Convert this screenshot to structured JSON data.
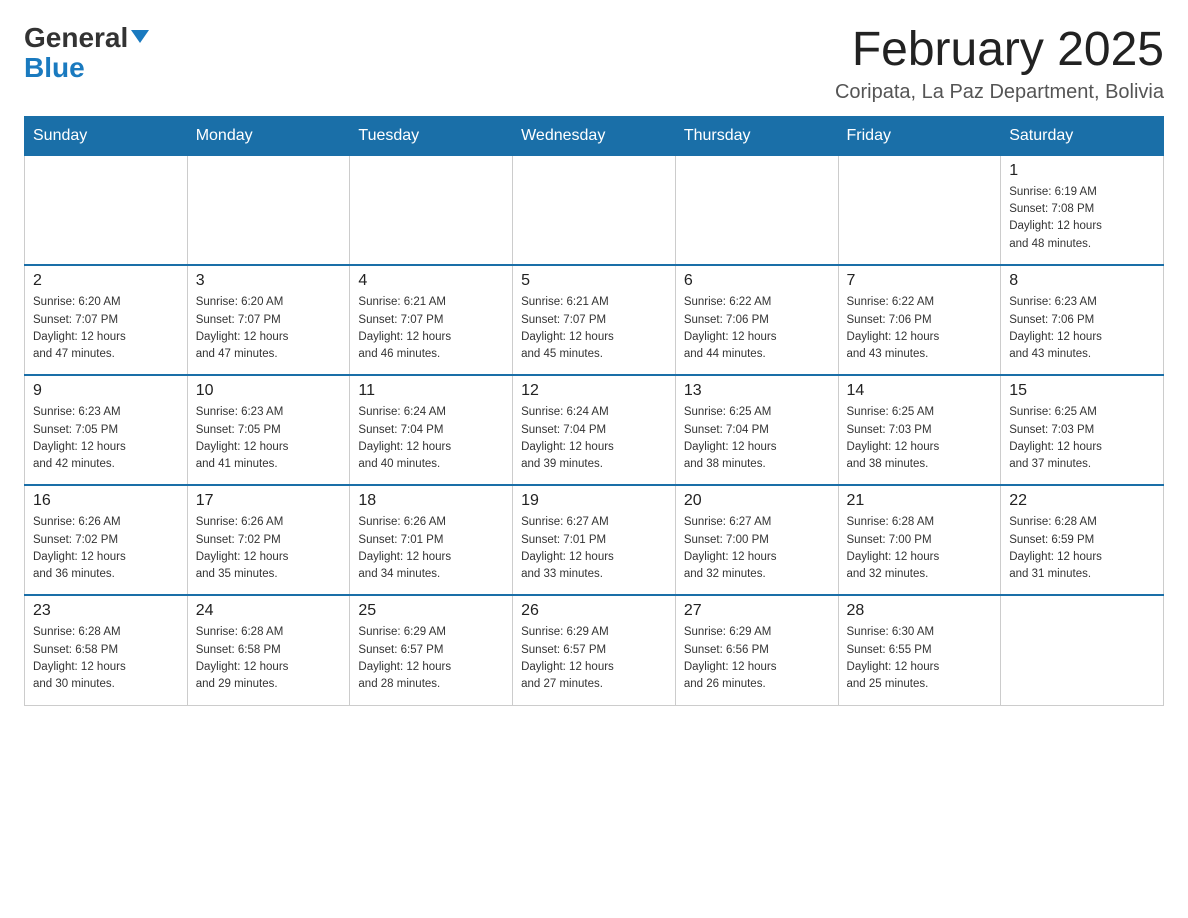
{
  "logo": {
    "part1": "General",
    "part2": "Blue"
  },
  "title": {
    "month": "February 2025",
    "location": "Coripata, La Paz Department, Bolivia"
  },
  "headers": [
    "Sunday",
    "Monday",
    "Tuesday",
    "Wednesday",
    "Thursday",
    "Friday",
    "Saturday"
  ],
  "weeks": [
    [
      {
        "day": "",
        "info": ""
      },
      {
        "day": "",
        "info": ""
      },
      {
        "day": "",
        "info": ""
      },
      {
        "day": "",
        "info": ""
      },
      {
        "day": "",
        "info": ""
      },
      {
        "day": "",
        "info": ""
      },
      {
        "day": "1",
        "info": "Sunrise: 6:19 AM\nSunset: 7:08 PM\nDaylight: 12 hours\nand 48 minutes."
      }
    ],
    [
      {
        "day": "2",
        "info": "Sunrise: 6:20 AM\nSunset: 7:07 PM\nDaylight: 12 hours\nand 47 minutes."
      },
      {
        "day": "3",
        "info": "Sunrise: 6:20 AM\nSunset: 7:07 PM\nDaylight: 12 hours\nand 47 minutes."
      },
      {
        "day": "4",
        "info": "Sunrise: 6:21 AM\nSunset: 7:07 PM\nDaylight: 12 hours\nand 46 minutes."
      },
      {
        "day": "5",
        "info": "Sunrise: 6:21 AM\nSunset: 7:07 PM\nDaylight: 12 hours\nand 45 minutes."
      },
      {
        "day": "6",
        "info": "Sunrise: 6:22 AM\nSunset: 7:06 PM\nDaylight: 12 hours\nand 44 minutes."
      },
      {
        "day": "7",
        "info": "Sunrise: 6:22 AM\nSunset: 7:06 PM\nDaylight: 12 hours\nand 43 minutes."
      },
      {
        "day": "8",
        "info": "Sunrise: 6:23 AM\nSunset: 7:06 PM\nDaylight: 12 hours\nand 43 minutes."
      }
    ],
    [
      {
        "day": "9",
        "info": "Sunrise: 6:23 AM\nSunset: 7:05 PM\nDaylight: 12 hours\nand 42 minutes."
      },
      {
        "day": "10",
        "info": "Sunrise: 6:23 AM\nSunset: 7:05 PM\nDaylight: 12 hours\nand 41 minutes."
      },
      {
        "day": "11",
        "info": "Sunrise: 6:24 AM\nSunset: 7:04 PM\nDaylight: 12 hours\nand 40 minutes."
      },
      {
        "day": "12",
        "info": "Sunrise: 6:24 AM\nSunset: 7:04 PM\nDaylight: 12 hours\nand 39 minutes."
      },
      {
        "day": "13",
        "info": "Sunrise: 6:25 AM\nSunset: 7:04 PM\nDaylight: 12 hours\nand 38 minutes."
      },
      {
        "day": "14",
        "info": "Sunrise: 6:25 AM\nSunset: 7:03 PM\nDaylight: 12 hours\nand 38 minutes."
      },
      {
        "day": "15",
        "info": "Sunrise: 6:25 AM\nSunset: 7:03 PM\nDaylight: 12 hours\nand 37 minutes."
      }
    ],
    [
      {
        "day": "16",
        "info": "Sunrise: 6:26 AM\nSunset: 7:02 PM\nDaylight: 12 hours\nand 36 minutes."
      },
      {
        "day": "17",
        "info": "Sunrise: 6:26 AM\nSunset: 7:02 PM\nDaylight: 12 hours\nand 35 minutes."
      },
      {
        "day": "18",
        "info": "Sunrise: 6:26 AM\nSunset: 7:01 PM\nDaylight: 12 hours\nand 34 minutes."
      },
      {
        "day": "19",
        "info": "Sunrise: 6:27 AM\nSunset: 7:01 PM\nDaylight: 12 hours\nand 33 minutes."
      },
      {
        "day": "20",
        "info": "Sunrise: 6:27 AM\nSunset: 7:00 PM\nDaylight: 12 hours\nand 32 minutes."
      },
      {
        "day": "21",
        "info": "Sunrise: 6:28 AM\nSunset: 7:00 PM\nDaylight: 12 hours\nand 32 minutes."
      },
      {
        "day": "22",
        "info": "Sunrise: 6:28 AM\nSunset: 6:59 PM\nDaylight: 12 hours\nand 31 minutes."
      }
    ],
    [
      {
        "day": "23",
        "info": "Sunrise: 6:28 AM\nSunset: 6:58 PM\nDaylight: 12 hours\nand 30 minutes."
      },
      {
        "day": "24",
        "info": "Sunrise: 6:28 AM\nSunset: 6:58 PM\nDaylight: 12 hours\nand 29 minutes."
      },
      {
        "day": "25",
        "info": "Sunrise: 6:29 AM\nSunset: 6:57 PM\nDaylight: 12 hours\nand 28 minutes."
      },
      {
        "day": "26",
        "info": "Sunrise: 6:29 AM\nSunset: 6:57 PM\nDaylight: 12 hours\nand 27 minutes."
      },
      {
        "day": "27",
        "info": "Sunrise: 6:29 AM\nSunset: 6:56 PM\nDaylight: 12 hours\nand 26 minutes."
      },
      {
        "day": "28",
        "info": "Sunrise: 6:30 AM\nSunset: 6:55 PM\nDaylight: 12 hours\nand 25 minutes."
      },
      {
        "day": "",
        "info": ""
      }
    ]
  ]
}
